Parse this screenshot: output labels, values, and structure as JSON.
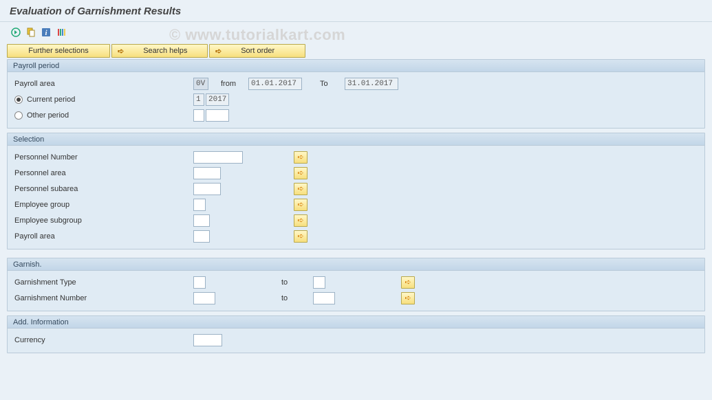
{
  "title": "Evaluation of Garnishment Results",
  "watermark": "© www.tutorialkart.com",
  "button_row": {
    "further_selections": "Further selections",
    "search_helps": "Search helps",
    "sort_order": "Sort order"
  },
  "payroll_period": {
    "group_title": "Payroll period",
    "payroll_area_label": "Payroll area",
    "payroll_area_value": "0V",
    "from_label": "from",
    "from_value": "01.01.2017",
    "to_label": "To",
    "to_value": "31.01.2017",
    "current_period_label": "Current period",
    "current_period_num": "1",
    "current_period_year": "2017",
    "other_period_label": "Other period"
  },
  "selection": {
    "group_title": "Selection",
    "personnel_number": "Personnel Number",
    "personnel_area": "Personnel area",
    "personnel_subarea": "Personnel subarea",
    "employee_group": "Employee group",
    "employee_subgroup": "Employee subgroup",
    "payroll_area": "Payroll area"
  },
  "garnish": {
    "group_title": "Garnish.",
    "type_label": "Garnishment Type",
    "number_label": "Garnishment Number",
    "to_label": "to"
  },
  "add_info": {
    "group_title": "Add. Information",
    "currency_label": "Currency"
  }
}
